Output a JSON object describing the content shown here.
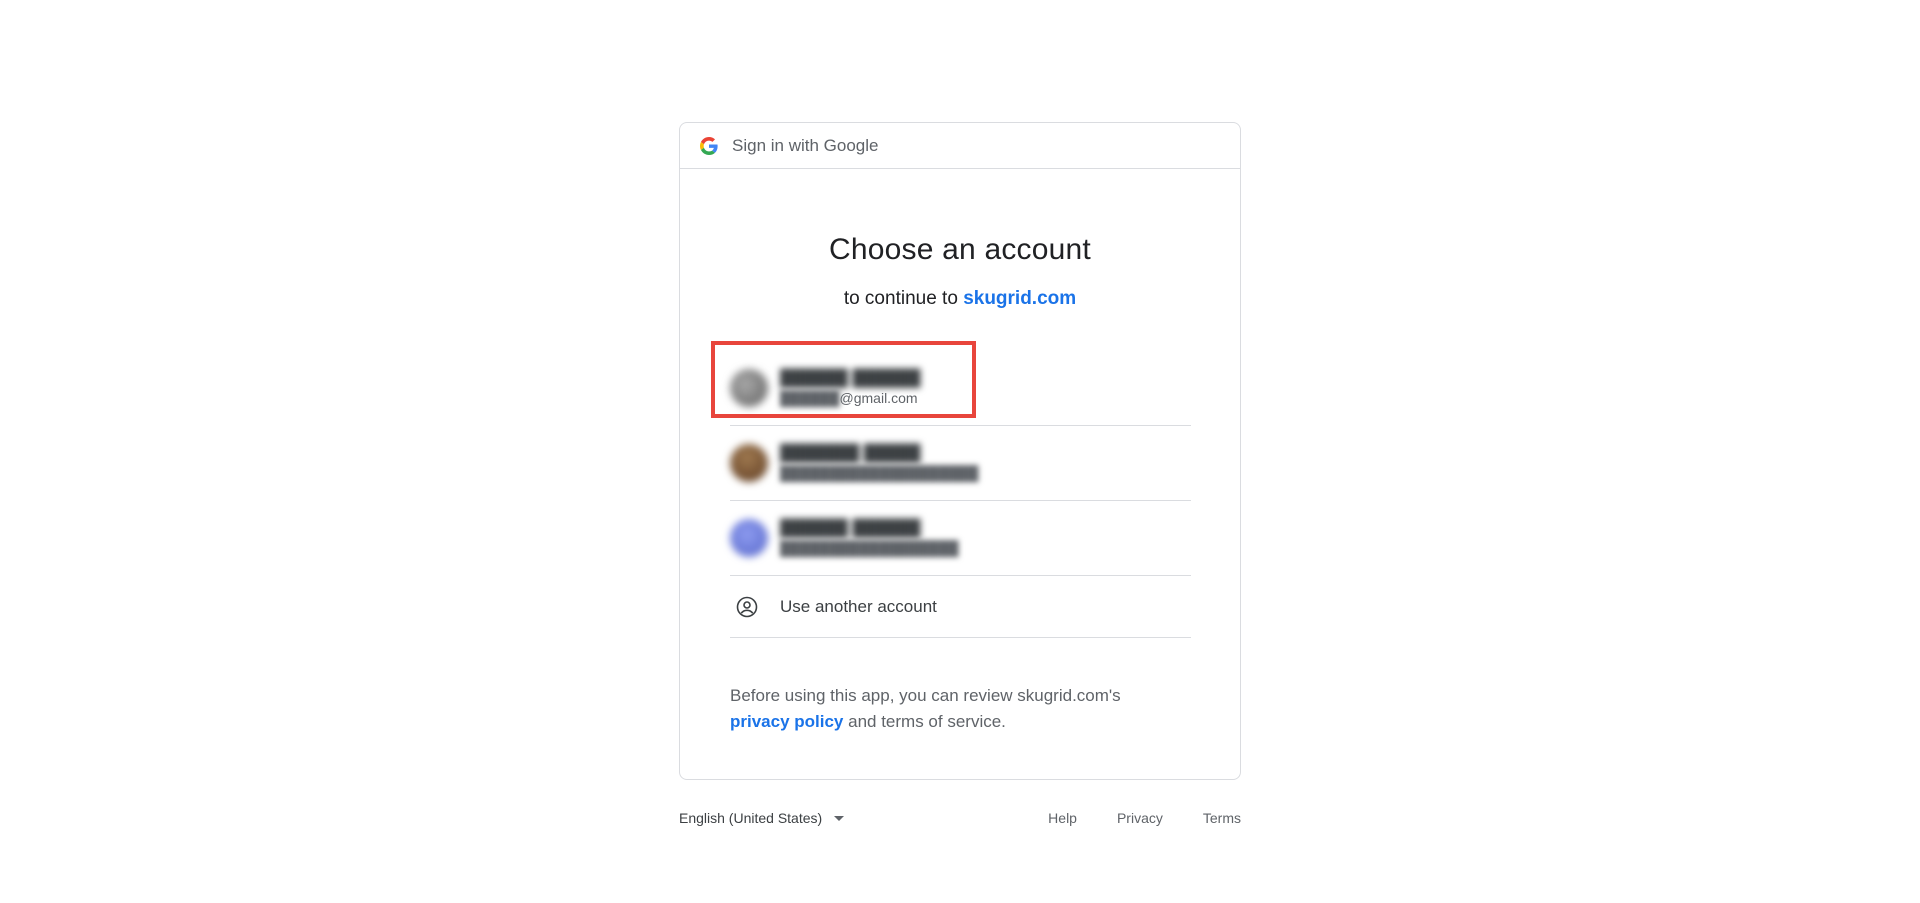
{
  "header": {
    "title": "Sign in with Google"
  },
  "main": {
    "title": "Choose an account",
    "subtitle_prefix": "to continue to",
    "site": "skugrid.com"
  },
  "accounts": [
    {
      "email_visible": "@gmail.com",
      "avatar_color": "#7a7a7a"
    },
    {
      "avatar_color": "#8a5a3a"
    },
    {
      "avatar_color": "#6b7bd6"
    }
  ],
  "use_another": {
    "label": "Use another account"
  },
  "disclaimer": {
    "text_before": "Before using this app, you can review skugrid.com's",
    "privacy_link": "privacy policy",
    "text_after": "and terms of service."
  },
  "footer": {
    "language": "English (United States)",
    "links": {
      "help": "Help",
      "privacy": "Privacy",
      "terms": "Terms"
    }
  },
  "colors": {
    "accent": "#1a73e8",
    "highlight": "#e8453c",
    "border": "#dadce0"
  },
  "icons": {
    "logo": "google-g-icon",
    "another": "account-circle-icon",
    "dropdown": "caret-down-icon"
  }
}
